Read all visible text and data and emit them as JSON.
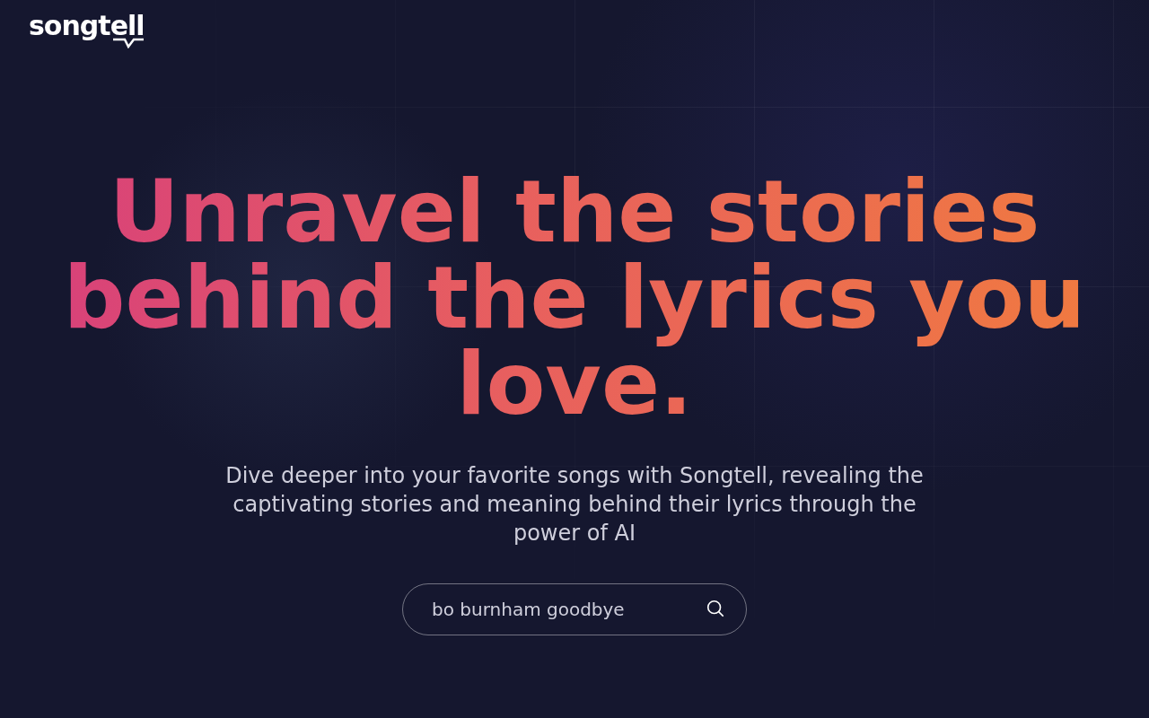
{
  "header": {
    "logo": "songtell"
  },
  "hero": {
    "title": "Unravel the stories behind the lyrics you love.",
    "subtitle": "Dive deeper into your favorite songs with Songtell, revealing the captivating stories and meaning behind their lyrics through the power of AI"
  },
  "search": {
    "value": "bo burnham goodbye"
  }
}
